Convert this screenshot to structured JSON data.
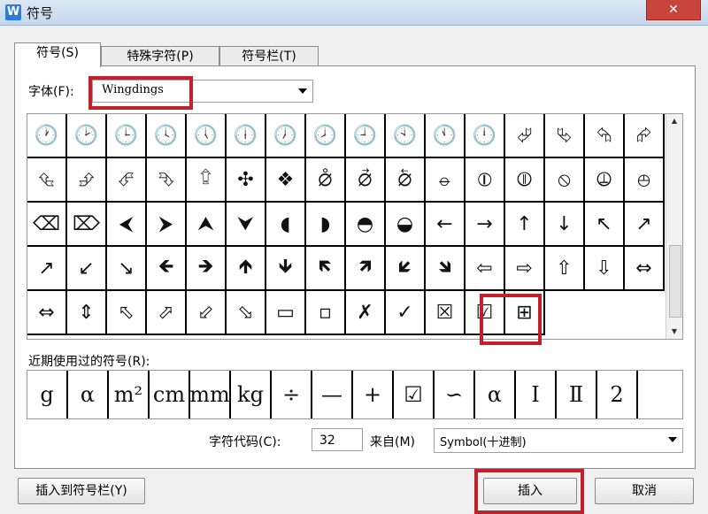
{
  "window": {
    "title": "符号",
    "app_icon": "W",
    "close_label": "✕"
  },
  "tabs": [
    "符号(S)",
    "特殊字符(P)",
    "符号栏(T)"
  ],
  "font": {
    "label": "字体(F):",
    "value": "Wingdings"
  },
  "symbol_grid": [
    [
      "🕐",
      "🕑",
      "🕒",
      "🕓",
      "🕔",
      "🕕",
      "🕖",
      "🕗",
      "🕘",
      "🕙",
      "🕚",
      "🕛",
      "⮰",
      "⮱",
      "⮲",
      "⮳"
    ],
    [
      "⮴",
      "⮵",
      "⮶",
      "⮷",
      "⮸",
      "✣",
      "❖",
      "⦲",
      "⦳",
      "⦴",
      "⦵",
      "⦶",
      "⦷",
      "⦸",
      "⦹",
      "⦺"
    ],
    [
      "⌫",
      "⌦",
      "⮜",
      "⮞",
      "⮝",
      "⮟",
      "◖",
      "◗",
      "◓",
      "◒",
      "←",
      "→",
      "↑",
      "↓",
      "↖",
      "↗"
    ],
    [
      "↗",
      "↙",
      "↘",
      "🡸",
      "🡺",
      "🡹",
      "🡻",
      "🡼",
      "🡽",
      "🡿",
      "🡾",
      "⇦",
      "⇨",
      "⇧",
      "⇩",
      "⇔"
    ],
    [
      "⇔",
      "⇕",
      "⬁",
      "⬀",
      "⬃",
      "⬂",
      "▭",
      "▫",
      "✗",
      "✓",
      "☒",
      "☑",
      "⊞",
      "",
      "",
      ""
    ]
  ],
  "recent": {
    "label": "近期使用过的符号(R):",
    "symbols": [
      "g",
      "α",
      "m²",
      "cm",
      "mm",
      "kg",
      "÷",
      "—",
      "+",
      "☑",
      "∽",
      "α",
      "Ⅰ",
      "Ⅱ",
      "2",
      ""
    ]
  },
  "char_code": {
    "label": "字符代码(C):",
    "value": "32"
  },
  "from": {
    "label": "来自(M)",
    "value": "Symbol(十进制)"
  },
  "buttons": {
    "insert_to_bar": "插入到符号栏(Y)",
    "insert": "插入",
    "cancel": "取消"
  },
  "colors": {
    "highlight": "#c4202b"
  }
}
